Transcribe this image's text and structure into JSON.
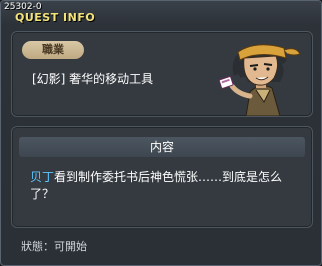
{
  "window": {
    "quest_id": "25302-0",
    "title": "QUEST INFO"
  },
  "quest": {
    "job_tag": "職業",
    "name": "[幻影] 奢华的移动工具"
  },
  "content": {
    "header": "内容",
    "npc_name": "贝丁",
    "description_rest": "看到制作委托书后神色慌张……到底是怎么了？"
  },
  "status": {
    "text": "狀態：可開始"
  },
  "colors": {
    "title_yellow": "#f2e27a",
    "npc_link_blue": "#5ec6ff",
    "tag_bg": "#d9c8a6"
  },
  "icons": {
    "npc_portrait": "npc-portrait-icon",
    "close": "close-icon"
  }
}
